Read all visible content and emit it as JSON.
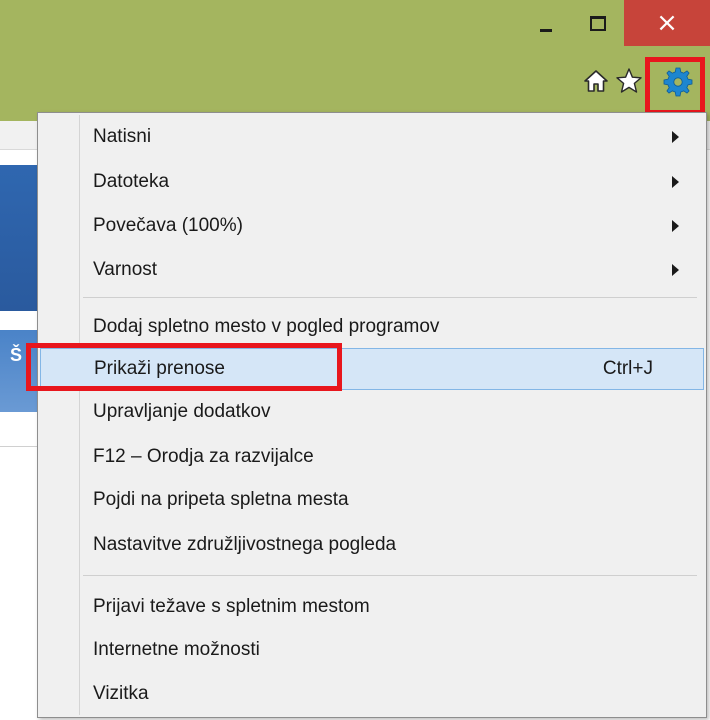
{
  "window_controls": {
    "close_glyph": "×"
  },
  "toolbar": {
    "icons": [
      "home-icon",
      "star-icon",
      "gear-icon"
    ]
  },
  "page": {
    "side_text": "Š"
  },
  "menu": {
    "items": [
      {
        "label": "Natisni",
        "submenu": true
      },
      {
        "label": "Datoteka",
        "submenu": true
      },
      {
        "label": "Povečava (100%)",
        "submenu": true
      },
      {
        "label": "Varnost",
        "submenu": true
      },
      {
        "label": "Dodaj spletno mesto v pogled programov"
      },
      {
        "label": "Prikaži prenose",
        "shortcut": "Ctrl+J",
        "hovered": true
      },
      {
        "label": "Upravljanje dodatkov"
      },
      {
        "label": "F12 – Orodja za razvijalce"
      },
      {
        "label": "Pojdi na pripeta spletna mesta"
      },
      {
        "label": "Nastavitve združljivostnega pogleda"
      },
      {
        "label": "Prijavi težave s spletnim mestom"
      },
      {
        "label": "Internetne možnosti"
      },
      {
        "label": "Vizitka"
      }
    ]
  },
  "colors": {
    "titlebar": "#a4b55f",
    "close_button": "#c7443a",
    "highlight_outline": "#e8161d",
    "menu_background": "#f0f0f0",
    "menu_hover": "#d5e6f7",
    "gear_icon": "#1d86d0"
  }
}
